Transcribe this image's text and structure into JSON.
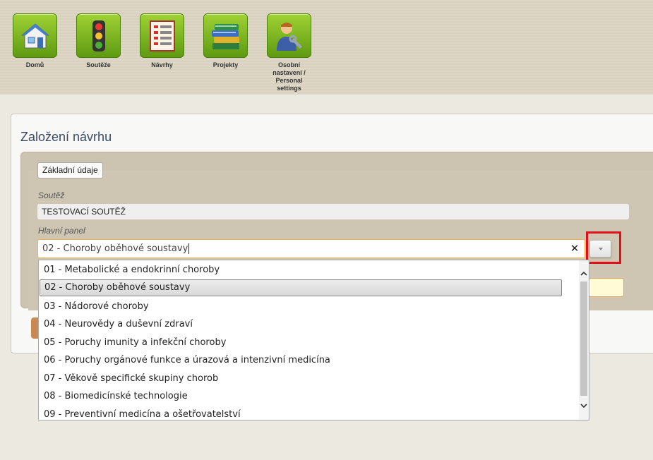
{
  "nav": {
    "items": [
      {
        "label": "Domů",
        "icon": "house-icon"
      },
      {
        "label": "Soutěže",
        "icon": "traffic-light-icon"
      },
      {
        "label": "Návrhy",
        "icon": "document-list-icon"
      },
      {
        "label": "Projekty",
        "icon": "books-icon"
      },
      {
        "label": "Osobní nastavení / Personal settings",
        "icon": "user-wrench-icon"
      }
    ]
  },
  "page": {
    "title": "Založení návrhu",
    "legend": "Základní údaje"
  },
  "form": {
    "competition_label": "Soutěž",
    "competition_value": "TESTOVACÍ SOUTĚŽ",
    "panel_label": "Hlavní panel",
    "panel_value": "02 - Choroby oběhové soustavy",
    "clear_symbol": "✕"
  },
  "dropdown": {
    "options": [
      "01 - Metabolické a endokrinní choroby",
      "02 - Choroby oběhové soustavy",
      "03 - Nádorové choroby",
      "04 - Neurovědy a duševní zdraví",
      "05 - Poruchy imunity a infekční choroby",
      "06 - Poruchy orgánové funkce a úrazová a intenzivní medicína",
      "07 - Věkově specifické skupiny chorob",
      "08 - Biomedicínské technologie",
      "09 - Preventivní medicína a ošetřovatelství"
    ],
    "selected_index": 1
  },
  "colors": {
    "nav_tile": "#7cb81f",
    "highlight": "#e0101b",
    "combo_border": "#f0b54a",
    "title": "#3b4a63"
  }
}
